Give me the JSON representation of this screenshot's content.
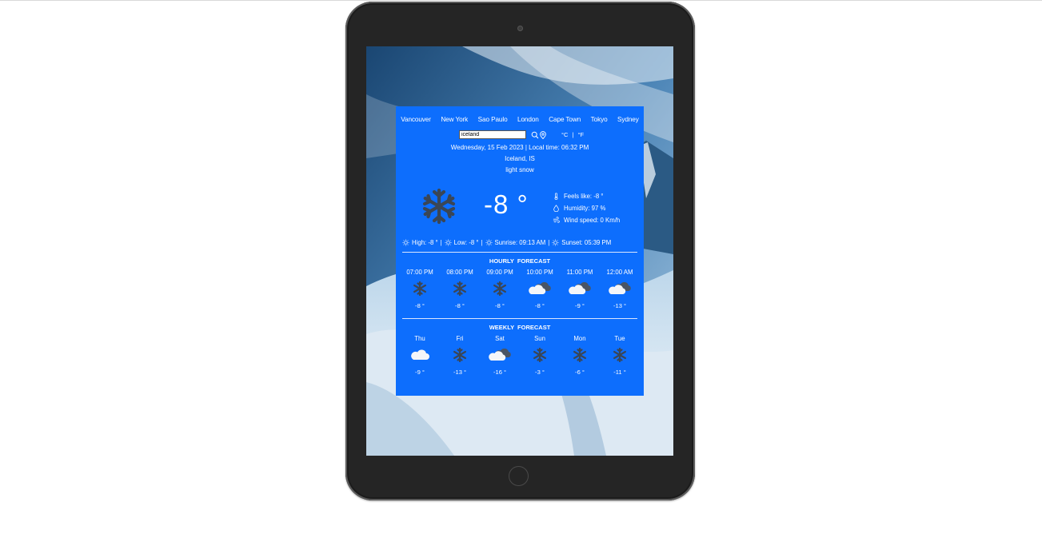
{
  "cities": [
    "Vancouver",
    "New York",
    "Sao Paulo",
    "London",
    "Cape Town",
    "Tokyo",
    "Sydney"
  ],
  "search": {
    "value": "iceland",
    "placeholder": ""
  },
  "units": {
    "celsius": "°C",
    "separator": "|",
    "fahrenheit": "°F"
  },
  "datetime": "Wednesday, 15 Feb 2023 | Local time: 06:32 PM",
  "location": "Iceland, IS",
  "condition": "light snow",
  "current": {
    "icon": "snowflake-icon",
    "temp": "-8 °",
    "feels_like": "Feels like: -8 °",
    "humidity": "Humidity: 97 %",
    "wind": "Wind speed: 0 Km/h"
  },
  "stats": {
    "high": "High: -8 °",
    "low": "Low: -8 °",
    "sunrise": "Sunrise: 09:13 AM",
    "sunset": "Sunset: 05:39 PM",
    "sep": "|"
  },
  "hourly": {
    "title": "HOURLY FORECAST",
    "items": [
      {
        "label": "07:00 PM",
        "icon": "snowflake-icon",
        "temp": "-8 °"
      },
      {
        "label": "08:00 PM",
        "icon": "snowflake-icon",
        "temp": "-8 °"
      },
      {
        "label": "09:00 PM",
        "icon": "snowflake-icon",
        "temp": "-8 °"
      },
      {
        "label": "10:00 PM",
        "icon": "broken-clouds-icon",
        "temp": "-8 °"
      },
      {
        "label": "11:00 PM",
        "icon": "broken-clouds-icon",
        "temp": "-9 °"
      },
      {
        "label": "12:00 AM",
        "icon": "broken-clouds-icon",
        "temp": "-13 °"
      }
    ]
  },
  "weekly": {
    "title": "WEEKLY FORECAST",
    "items": [
      {
        "label": "Thu",
        "icon": "cloud-icon",
        "temp": "-9 °"
      },
      {
        "label": "Fri",
        "icon": "snowflake-icon",
        "temp": "-13 °"
      },
      {
        "label": "Sat",
        "icon": "broken-clouds-icon",
        "temp": "-16 °"
      },
      {
        "label": "Sun",
        "icon": "snowflake-icon",
        "temp": "-3 °"
      },
      {
        "label": "Mon",
        "icon": "snowflake-icon",
        "temp": "-6 °"
      },
      {
        "label": "Tue",
        "icon": "snowflake-icon",
        "temp": "-11 °"
      }
    ]
  },
  "colors": {
    "card": "#0d6efd",
    "icon_dark": "#3a4656",
    "text": "#ffffff"
  }
}
